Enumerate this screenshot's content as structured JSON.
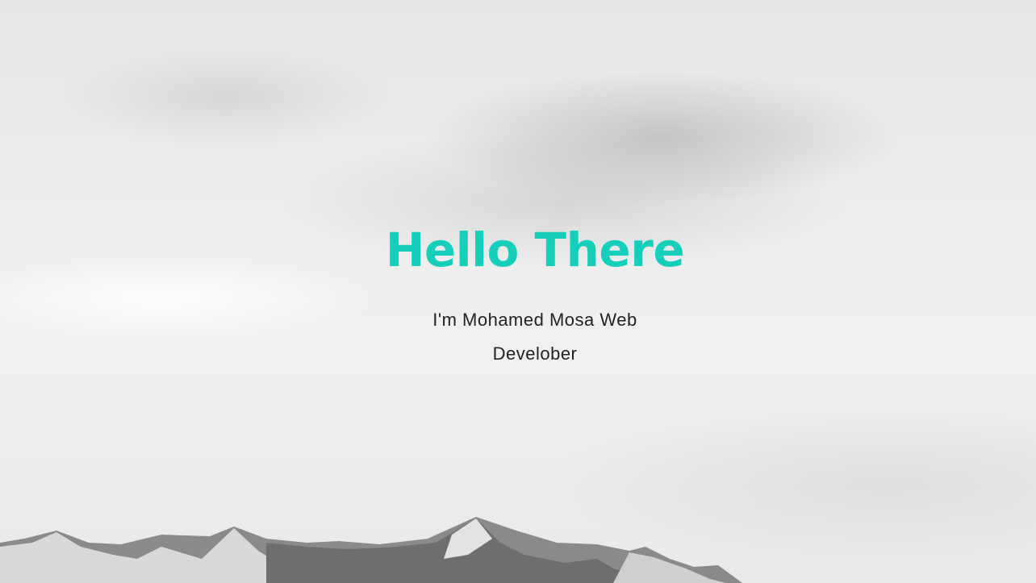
{
  "hero": {
    "title": "Hello There",
    "subtitle": "I'm Mohamed Mosa Web Develober",
    "title_color": "#16cfbb",
    "subtitle_color": "#222222",
    "background_image": "grayscale-cloudy-sky-with-snowy-mountains"
  }
}
